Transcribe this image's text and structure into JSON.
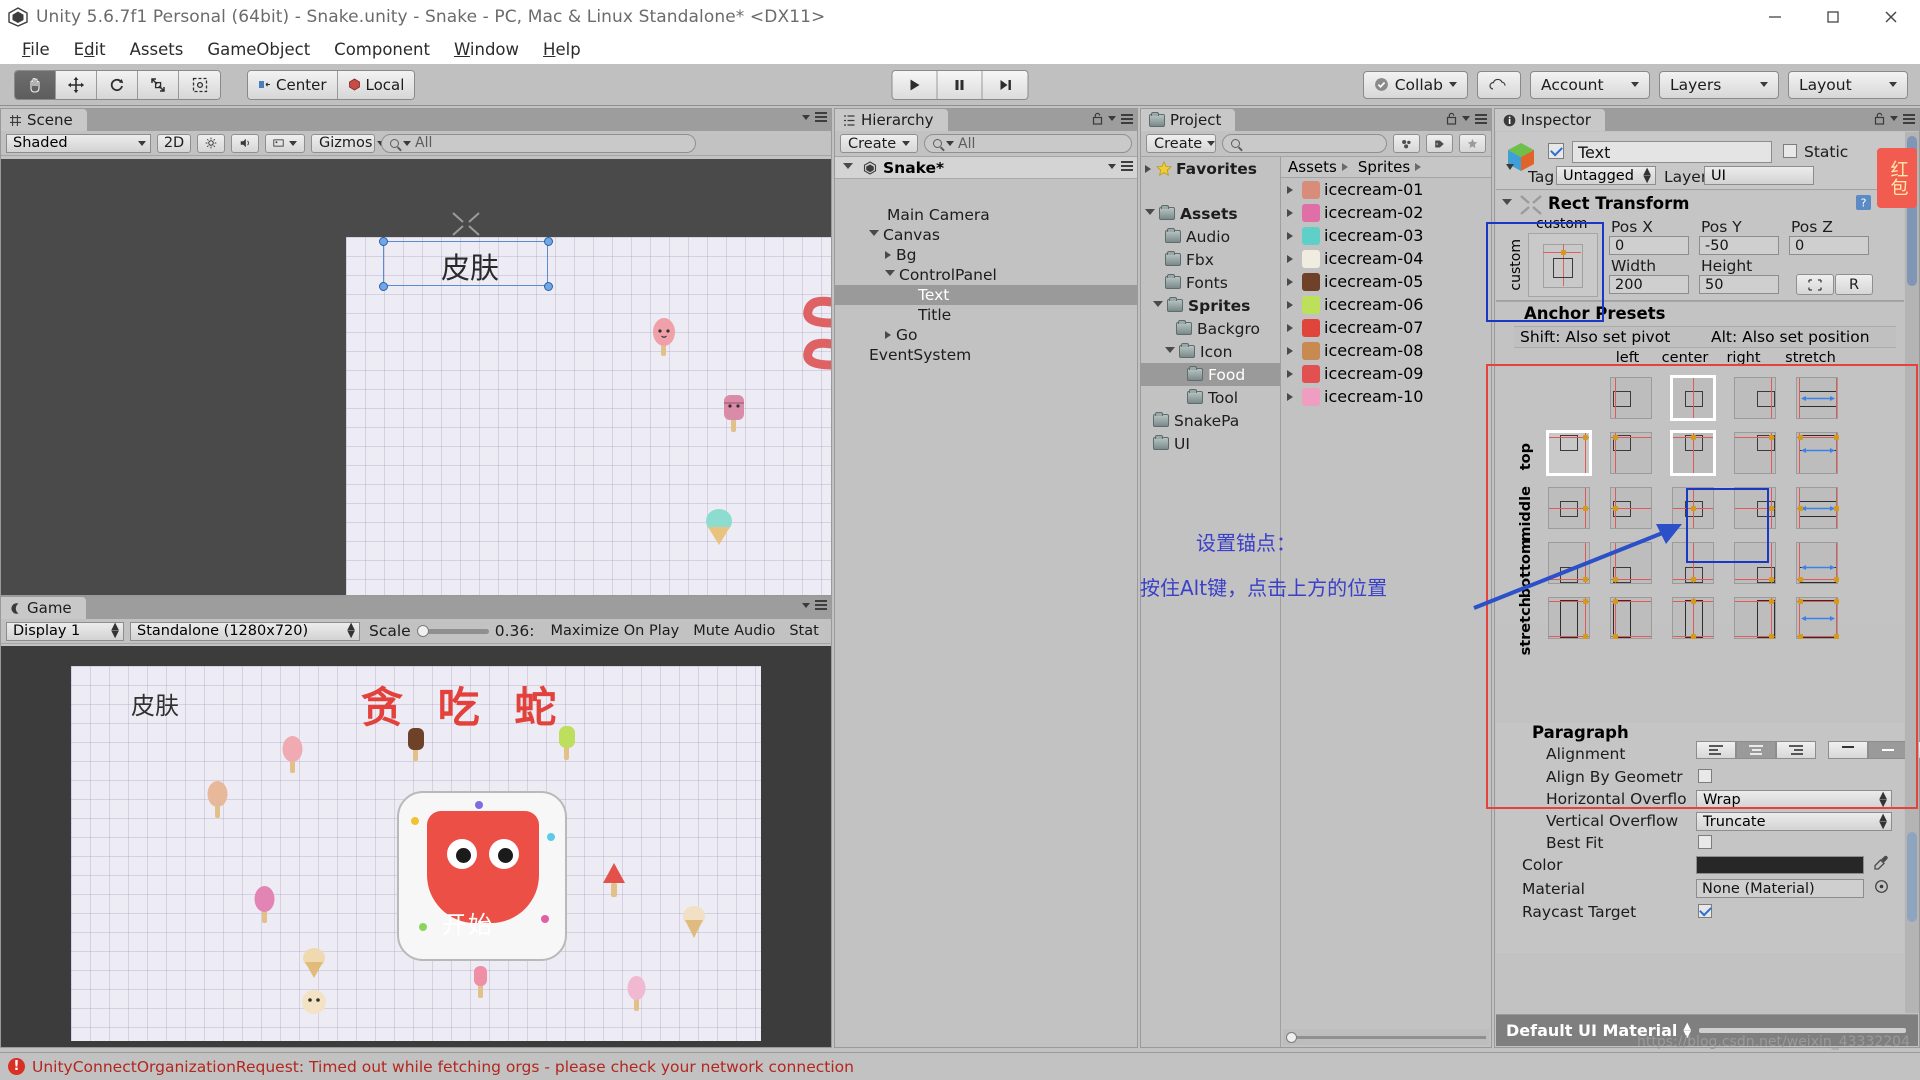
{
  "window": {
    "title": "Unity 5.6.7f1 Personal (64bit) - Snake.unity - Snake - PC, Mac & Linux Standalone* <DX11>",
    "app_icon": "unity-logo-icon",
    "minimize": "minimize-icon",
    "maximize": "maximize-icon",
    "close": "close-icon"
  },
  "menubar": {
    "items": [
      {
        "label": "File"
      },
      {
        "label": "Edit"
      },
      {
        "label": "Assets"
      },
      {
        "label": "GameObject"
      },
      {
        "label": "Component"
      },
      {
        "label": "Window"
      },
      {
        "label": "Help"
      }
    ]
  },
  "toolbar": {
    "tools": [
      {
        "name": "hand-tool",
        "glyph": "✋",
        "active": true
      },
      {
        "name": "move-tool",
        "glyph": "✥",
        "active": false
      },
      {
        "name": "rotate-tool",
        "glyph": "⟳",
        "active": false
      },
      {
        "name": "scale-tool",
        "glyph": "⤡",
        "active": false
      },
      {
        "name": "rect-tool",
        "glyph": "⧉",
        "active": false
      }
    ],
    "pivot_mode": "Center",
    "pivot_rotation": "Local",
    "play": "play-button",
    "pause": "pause-button",
    "step": "step-button",
    "collab": "Collab",
    "cloud": "cloud-button",
    "account": "Account",
    "layers": "Layers",
    "layout": "Layout"
  },
  "scene_panel": {
    "tab": "Scene",
    "tab_icon": "grid-icon",
    "shading": "Shaded",
    "mode_2d": "2D",
    "lighting_icon": "lighting-icon",
    "audio_icon": "audio-icon",
    "effects_icon": "effects-icon",
    "gizmos": "Gizmos",
    "search_placeholder": "All",
    "object_label": "皮肤"
  },
  "game_panel": {
    "tab": "Game",
    "tab_icon": "gamepad-icon",
    "display": "Display 1",
    "aspect": "Standalone (1280x720)",
    "scale_label": "Scale",
    "scale_value": "0.36:",
    "maximize_on_play": "Maximize On Play",
    "mute_audio": "Mute Audio",
    "stats": "Stat",
    "skin_label": "皮肤",
    "game_title": "贪 吃 蛇",
    "start_button_label": "开始"
  },
  "hierarchy": {
    "tab": "Hierarchy",
    "tab_icon": "hierarchy-icon",
    "lock_icon": "lock-icon",
    "menu_icon": "menu-icon",
    "create_label": "Create",
    "search_placeholder": "All",
    "scene_name": "Snake*",
    "items": [
      {
        "label": "Snake*",
        "depth": 0,
        "arrow": "open",
        "bold": true,
        "icon": "unity-scene-icon",
        "selected": false
      },
      {
        "label": "Main Camera",
        "depth": 1,
        "arrow": "none",
        "selected": false
      },
      {
        "label": "Canvas",
        "depth": 1,
        "arrow": "open",
        "selected": false
      },
      {
        "label": "Bg",
        "depth": 2,
        "arrow": "closed",
        "selected": false
      },
      {
        "label": "ControlPanel",
        "depth": 2,
        "arrow": "open",
        "selected": false
      },
      {
        "label": "Text",
        "depth": 3,
        "arrow": "none",
        "selected": true
      },
      {
        "label": "Title",
        "depth": 3,
        "arrow": "none",
        "selected": false
      },
      {
        "label": "Go",
        "depth": 2,
        "arrow": "closed",
        "selected": false
      },
      {
        "label": "EventSystem",
        "depth": 1,
        "arrow": "none",
        "selected": false
      }
    ]
  },
  "project": {
    "tab": "Project",
    "tab_icon": "folder-icon",
    "lock_icon": "lock-icon",
    "menu_icon": "menu-icon",
    "create_label": "Create",
    "search_placeholder": "",
    "filter_type_icon": "type-filter-icon",
    "filter_label_icon": "label-filter-icon",
    "favorite_icon": "star-icon",
    "tree": [
      {
        "label": "Favorites",
        "depth": 0,
        "arrow": "closed",
        "icon": "star-icon",
        "bold": true,
        "selected": false
      },
      {
        "label": "",
        "depth": 0,
        "arrow": "none",
        "icon": "none",
        "spacer": true,
        "selected": false
      },
      {
        "label": "Assets",
        "depth": 0,
        "arrow": "open",
        "icon": "folder-icon",
        "bold": true,
        "selected": false
      },
      {
        "label": "Audio",
        "depth": 1,
        "arrow": "none",
        "icon": "folder-icon",
        "selected": false
      },
      {
        "label": "Fbx",
        "depth": 1,
        "arrow": "none",
        "icon": "folder-icon",
        "selected": false
      },
      {
        "label": "Fonts",
        "depth": 1,
        "arrow": "none",
        "icon": "folder-icon",
        "selected": false
      },
      {
        "label": "Sprites",
        "depth": 1,
        "arrow": "open",
        "icon": "folder-icon",
        "selected": false
      },
      {
        "label": "Backgro",
        "depth": 2,
        "arrow": "none",
        "icon": "folder-icon",
        "selected": false
      },
      {
        "label": "Icon",
        "depth": 2,
        "arrow": "open",
        "icon": "folder-icon",
        "selected": false
      },
      {
        "label": "Food",
        "depth": 3,
        "arrow": "none",
        "icon": "folder-icon",
        "selected": true
      },
      {
        "label": "Tool",
        "depth": 3,
        "arrow": "none",
        "icon": "folder-icon",
        "selected": false
      },
      {
        "label": "SnakePa",
        "depth": 1,
        "arrow": "none",
        "icon": "folder-icon",
        "selected": false
      },
      {
        "label": "UI",
        "depth": 1,
        "arrow": "none",
        "icon": "folder-icon",
        "selected": false
      }
    ],
    "breadcrumb": [
      "Assets",
      "Sprites"
    ],
    "assets": [
      {
        "name": "icecream-01",
        "color": "#d98c7a"
      },
      {
        "name": "icecream-02",
        "color": "#e06fa8"
      },
      {
        "name": "icecream-03",
        "color": "#5fd0c8"
      },
      {
        "name": "icecream-04",
        "color": "#f0ece0"
      },
      {
        "name": "icecream-05",
        "color": "#6e4228"
      },
      {
        "name": "icecream-06",
        "color": "#bde05a"
      },
      {
        "name": "icecream-07",
        "color": "#e0453c"
      },
      {
        "name": "icecream-08",
        "color": "#c98a52"
      },
      {
        "name": "icecream-09",
        "color": "#e35050"
      },
      {
        "name": "icecream-10",
        "color": "#ef9ec2"
      }
    ]
  },
  "inspector": {
    "tab": "Inspector",
    "tab_icon": "info-icon",
    "lock_icon": "lock-icon",
    "menu_icon": "menu-icon",
    "object_icon": "gameobject-icon",
    "enabled": true,
    "object_name": "Text",
    "static_label": "Static",
    "static_checked": false,
    "tag_label": "Tag",
    "tag_value": "Untagged",
    "layer_label": "Layer",
    "layer_value": "UI",
    "rect_transform": {
      "title": "Rect Transform",
      "anchor_preset_label": "custom",
      "anchor_side_label": "custom",
      "pos_x_label": "Pos X",
      "pos_y_label": "Pos Y",
      "pos_z_label": "Pos Z",
      "pos_x": "0",
      "pos_y": "-50",
      "pos_z": "0",
      "width_label": "Width",
      "height_label": "Height",
      "width": "200",
      "height": "50",
      "blueprint_icon": "blueprint-icon",
      "raw_label": "R",
      "help_icon": "help-icon",
      "settings_icon": "gear-icon"
    },
    "anchor_presets": {
      "title": "Anchor Presets",
      "hint_shift": "Shift: Also set pivot",
      "hint_alt": "Alt: Also set position",
      "columns": [
        "left",
        "center",
        "right",
        "stretch"
      ],
      "rows": [
        "top",
        "middle",
        "bottom",
        "stretch"
      ],
      "selected_row": "top",
      "selected_col": "center"
    },
    "paragraph": {
      "title": "Paragraph",
      "alignment_label": "Alignment",
      "align_by_geometry_label": "Align By Geometr",
      "align_by_geometry_checked": false,
      "horizontal_overflow_label": "Horizontal Overflo",
      "horizontal_overflow_value": "Wrap",
      "vertical_overflow_label": "Vertical Overflow",
      "vertical_overflow_value": "Truncate",
      "best_fit_label": "Best Fit",
      "best_fit_checked": false,
      "color_label": "Color",
      "color_value": "#272727",
      "color_picker_icon": "eyedropper-icon",
      "material_label": "Material",
      "material_value": "None (Material)",
      "material_select_icon": "target-icon",
      "raycast_target_label": "Raycast Target",
      "raycast_target_checked": true
    },
    "footer_material": "Default UI Material"
  },
  "annotation": {
    "line1": "设置锚点：",
    "line2": "按住Alt键，点击上方的位置",
    "color": "#3b40c8",
    "badge": "红包"
  },
  "statusbar": {
    "icon": "error-icon",
    "message": "UnityConnectOrganizationRequest: Timed out while fetching orgs - please check your network connection",
    "color": "#b3261e"
  },
  "watermark": "https://blog.csdn.net/weixin_43332204"
}
